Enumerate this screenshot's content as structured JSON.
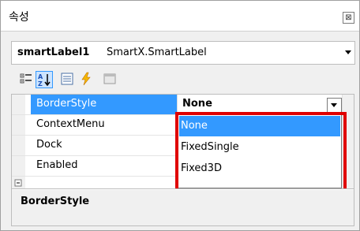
{
  "window": {
    "title": "속성"
  },
  "object_selector": {
    "name": "smartLabel1",
    "type": "SmartX.SmartLabel"
  },
  "toolbar": {
    "buttons": [
      {
        "icon": "categorized-icon"
      },
      {
        "icon": "alphabetical-sort-icon",
        "active": true
      },
      {
        "icon": "properties-icon"
      },
      {
        "icon": "events-lightning-icon"
      },
      {
        "icon": "property-pages-icon"
      }
    ]
  },
  "grid": {
    "selected_value": "None",
    "rows": [
      {
        "name": "BorderStyle",
        "value": "None"
      },
      {
        "name": "ContextMenu",
        "value": ""
      },
      {
        "name": "Dock",
        "value": ""
      },
      {
        "name": "Enabled",
        "value": ""
      }
    ]
  },
  "dropdown": {
    "options": [
      "None",
      "FixedSingle",
      "Fixed3D"
    ],
    "selected_index": 0,
    "highlight_color": "#e00000"
  },
  "description": {
    "title": "BorderStyle"
  },
  "colors": {
    "selection": "#3399ff",
    "highlight_border": "#e00000"
  }
}
